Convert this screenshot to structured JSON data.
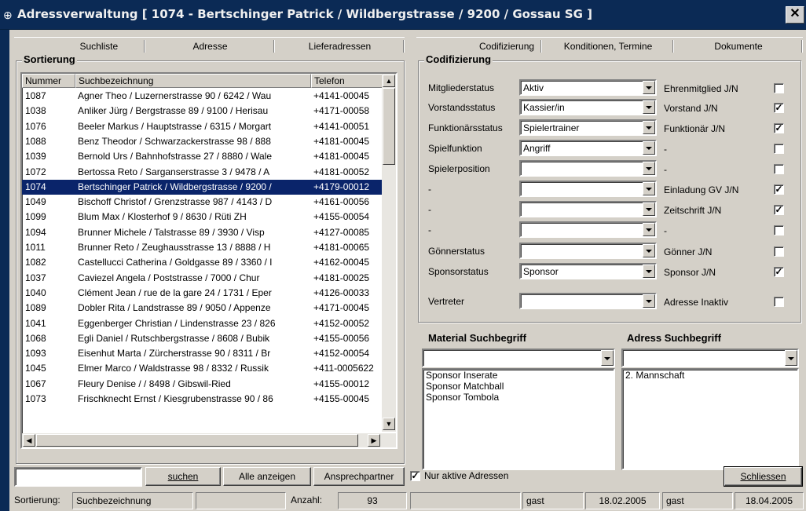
{
  "window": {
    "title": "Adressverwaltung  [ 1074 - Bertschinger Patrick / Wildbergstrasse / 9200 / Gossau SG ]",
    "close_glyph": "✕",
    "icon": "app-icon"
  },
  "left_tabs": [
    "Suchliste",
    "Adresse",
    "Lieferadressen"
  ],
  "right_tabs": [
    "Codifizierung",
    "Konditionen, Termine",
    "Dokumente"
  ],
  "sortierung": {
    "title": "Sortierung",
    "columns": [
      "Nummer",
      "Suchbezeichnung",
      "Telefon"
    ],
    "rows": [
      [
        "1087",
        "Agner Theo / Luzernerstrasse 90 / 6242 / Wau",
        "+4141-00045"
      ],
      [
        "1038",
        "Anliker Jürg / Bergstrasse 89 / 9100 / Herisau",
        "+4171-00058"
      ],
      [
        "1076",
        "Beeler Markus / Hauptstrasse / 6315 / Morgart",
        "+4141-00051"
      ],
      [
        "1088",
        "Benz Theodor / Schwarzackerstrasse 98 / 888",
        "+4181-00045"
      ],
      [
        "1039",
        "Bernold Urs / Bahnhofstrasse 27 / 8880 / Wale",
        "+4181-00045"
      ],
      [
        "1072",
        "Bertossa Reto / Sarganserstrasse 3 / 9478 / A",
        "+4181-00052"
      ],
      [
        "1074",
        "Bertschinger Patrick / Wildbergstrasse / 9200 /",
        "+4179-00012"
      ],
      [
        "1049",
        "Bischoff Christof / Grenzstrasse 987 / 4143 / D",
        "+4161-00056"
      ],
      [
        "1099",
        "Blum Max / Klosterhof 9 / 8630 / Rüti ZH",
        "+4155-00054"
      ],
      [
        "1094",
        "Brunner Michele / Talstrasse 89 / 3930 / Visp",
        "+4127-00085"
      ],
      [
        "1011",
        "Brunner Reto / Zeughausstrasse 13 / 8888 / H",
        "+4181-00065"
      ],
      [
        "1082",
        "Castellucci Catherina / Goldgasse 89 / 3360 / I",
        "+4162-00045"
      ],
      [
        "1037",
        "Caviezel Angela / Poststrasse / 7000 / Chur",
        "+4181-00025"
      ],
      [
        "1040",
        "Clément Jean / rue de la gare 24 / 1731 / Eper",
        "+4126-00033"
      ],
      [
        "1089",
        "Dobler Rita / Landstrasse 89 / 9050 / Appenze",
        "+4171-00045"
      ],
      [
        "1041",
        "Eggenberger Christian / Lindenstrasse 23 / 826",
        "+4152-00052"
      ],
      [
        "1068",
        "Egli Daniel / Rutschbergstrasse / 8608 / Bubik",
        "+4155-00056"
      ],
      [
        "1093",
        "Eisenhut Marta / Zürcherstrasse 90 / 8311 / Br",
        "+4152-00054"
      ],
      [
        "1045",
        "Elmer Marco / Waldstrasse 98 / 8332 / Russik",
        "+411-0005622"
      ],
      [
        "1067",
        "Fleury Denise /  / 8498 / Gibswil-Ried",
        "+4155-00012"
      ],
      [
        "1073",
        "Frischknecht Ernst / Kiesgrubenstrasse 90 / 86",
        "+4155-00045"
      ]
    ],
    "selected_index": 6
  },
  "codifizierung": {
    "title": "Codifizierung",
    "fields": [
      {
        "label": "Mitgliederstatus",
        "value": "Aktiv",
        "flag_label": "Ehrenmitglied J/N",
        "checked": false
      },
      {
        "label": "Vorstandsstatus",
        "value": "Kassier/in",
        "flag_label": "Vorstand J/N",
        "checked": true
      },
      {
        "label": "Funktionärsstatus",
        "value": "Spielertrainer",
        "flag_label": "Funktionär J/N",
        "checked": true
      },
      {
        "label": "Spielfunktion",
        "value": "Angriff",
        "flag_label": "-",
        "checked": false
      },
      {
        "label": "Spielerposition",
        "value": "",
        "flag_label": "-",
        "checked": false
      },
      {
        "label": "-",
        "value": "",
        "flag_label": "Einladung GV J/N",
        "checked": true
      },
      {
        "label": "-",
        "value": "",
        "flag_label": "Zeitschrift J/N",
        "checked": true
      },
      {
        "label": "-",
        "value": "",
        "flag_label": "-",
        "checked": false
      },
      {
        "label": "Gönnerstatus",
        "value": "",
        "flag_label": "Gönner J/N",
        "checked": false
      },
      {
        "label": "Sponsorstatus",
        "value": "Sponsor",
        "flag_label": "Sponsor J/N",
        "checked": true
      },
      {
        "label": "Vertreter",
        "value": "",
        "flag_label": "Adresse Inaktiv",
        "checked": false
      }
    ],
    "material_title": "Material Suchbegriff",
    "material_items": [
      "Sponsor Inserate",
      "Sponsor Matchball",
      "Sponsor Tombola"
    ],
    "adress_title": "Adress Suchbegriff",
    "adress_items": [
      "2. Mannschaft"
    ]
  },
  "toolbar": {
    "search_value": "",
    "suchen": "suchen",
    "alle_anzeigen": "Alle anzeigen",
    "ansprechpartner": "Ansprechpartner",
    "nur_aktive_label": "Nur aktive Adressen",
    "nur_aktive_checked": true,
    "schliessen": "Schliessen"
  },
  "statusbar": {
    "sortierung_label": "Sortierung:",
    "sortierung_value": "Suchbezeichnung",
    "empty": "",
    "anzahl_label": "Anzahl:",
    "anzahl_value": "93",
    "user1": "gast",
    "date1": "18.02.2005",
    "user2": "gast",
    "date2": "18.04.2005"
  }
}
